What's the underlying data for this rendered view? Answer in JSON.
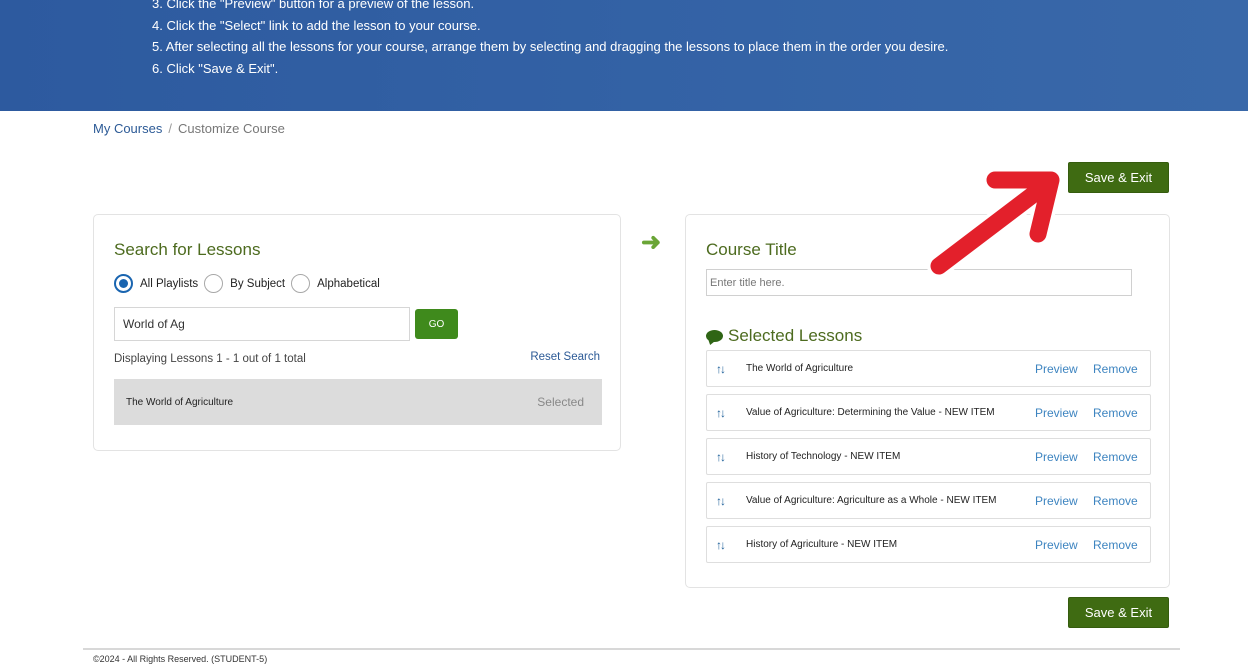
{
  "instructions": [
    "3. Click the \"Preview\" button for a preview of the lesson.",
    "4. Click the \"Select\" link to add the lesson to your course.",
    "5. After selecting all the lessons for your course, arrange them by selecting and dragging the lessons to place them in the order you desire.",
    "6. Click \"Save & Exit\"."
  ],
  "breadcrumb": {
    "home": "My Courses",
    "separator": "/",
    "current": "Customize Course"
  },
  "save_exit_label": "Save & Exit",
  "search": {
    "heading": "Search for Lessons",
    "radios": [
      {
        "label": "All Playlists",
        "checked": true
      },
      {
        "label": "By Subject",
        "checked": false
      },
      {
        "label": "Alphabetical",
        "checked": false
      }
    ],
    "query": "World of Ag",
    "go_label": "GO",
    "display_text": "Displaying Lessons 1 - 1 out of 1 total",
    "reset_label": "Reset Search",
    "results": [
      {
        "title": "The World of Agriculture",
        "status": "Selected"
      }
    ]
  },
  "course": {
    "heading": "Course Title",
    "title_placeholder": "Enter title here.",
    "title_value": "",
    "selected_heading": "Selected Lessons",
    "drag_glyph": "↑↓",
    "preview_label": "Preview",
    "remove_label": "Remove",
    "lessons": [
      "The World of Agriculture",
      "Value of Agriculture: Determining the Value - NEW ITEM",
      "History of Technology - NEW ITEM",
      "Value of Agriculture: Agriculture as a Whole - NEW ITEM",
      "History of Agriculture - NEW ITEM"
    ]
  },
  "footer": "©2024 - All Rights Reserved. (STUDENT-5)",
  "colors": {
    "banner": "#3463a6",
    "accent_green": "#3f6b12",
    "link_blue": "#2c5a96",
    "annotation_red": "#e3202b"
  }
}
